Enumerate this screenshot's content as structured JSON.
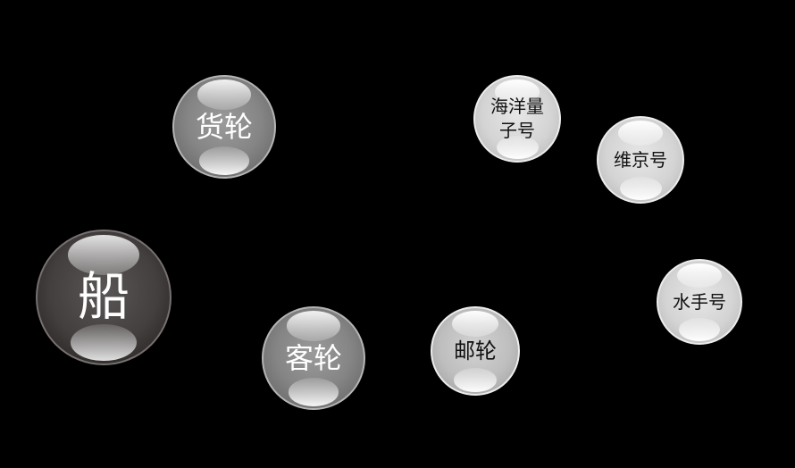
{
  "diagram": {
    "root": {
      "label": "船"
    },
    "categories": [
      {
        "label": "货轮"
      },
      {
        "label": "客轮"
      }
    ],
    "subcategory": {
      "label": "邮轮"
    },
    "ships": [
      {
        "label": "海洋量子号"
      },
      {
        "label": "维京号"
      },
      {
        "label": "水手号"
      }
    ]
  },
  "colors": {
    "background": "#000000",
    "root_sphere": "#443f3f",
    "category_sphere": "#858585",
    "leaf_sphere": "#d4d4d4",
    "dark_label": "#111111",
    "light_label": "#ffffff"
  }
}
